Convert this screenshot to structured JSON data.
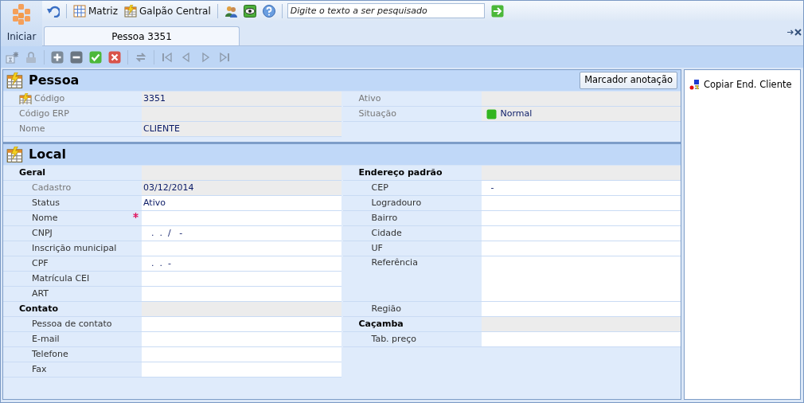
{
  "app_button": {
    "label": "Iniciar"
  },
  "top_toolbar": {
    "items": [
      {
        "kind": "undo"
      },
      {
        "kind": "grid",
        "label": "Matriz"
      },
      {
        "kind": "table",
        "label": "Galpão Central"
      },
      {
        "kind": "users"
      },
      {
        "kind": "eye"
      },
      {
        "kind": "help"
      }
    ],
    "search": {
      "placeholder": "Digite o texto a ser pesquisado"
    }
  },
  "tabs": [
    {
      "label": "Pessoa 3351",
      "selected": true
    }
  ],
  "record_toolbar": [
    {
      "kind": "new",
      "disabled": true
    },
    {
      "kind": "lock",
      "disabled": true
    },
    {
      "kind": "add",
      "disabled": false
    },
    {
      "kind": "remove",
      "disabled": false
    },
    {
      "kind": "save",
      "disabled": false
    },
    {
      "kind": "cancel",
      "disabled": false
    },
    {
      "kind": "refresh",
      "disabled": true
    },
    {
      "kind": "first",
      "disabled": true
    },
    {
      "kind": "prev",
      "disabled": true
    },
    {
      "kind": "next",
      "disabled": true
    },
    {
      "kind": "last",
      "disabled": true
    }
  ],
  "pessoa": {
    "title": "Pessoa",
    "button": "Marcador anotação",
    "left": [
      {
        "kind": "key_field",
        "label": "Código",
        "value": "3351",
        "readonly": true
      },
      {
        "kind": "field",
        "label": "Código ERP",
        "readonly": true
      },
      {
        "kind": "field",
        "label": "Nome",
        "value": "CLIENTE",
        "readonly": true
      }
    ],
    "right": [
      {
        "kind": "field",
        "label": "Ativo",
        "readonly": true
      },
      {
        "kind": "status",
        "label": "Situação",
        "value": "Normal",
        "readonly": true,
        "color": "#33b51e"
      }
    ]
  },
  "local": {
    "title": "Local",
    "left": [
      {
        "kind": "group",
        "label": "Geral"
      },
      {
        "kind": "field",
        "label": "Cadastro",
        "value": "03/12/2014",
        "readonly": true,
        "required": false
      },
      {
        "kind": "field",
        "label": "Status",
        "value": "Ativo",
        "readonly": false,
        "required": false
      },
      {
        "kind": "field",
        "label": "Nome",
        "readonly": false,
        "required": true
      },
      {
        "kind": "field",
        "label": "CNPJ",
        "value": ".  .  /   -",
        "readonly": false,
        "required": false
      },
      {
        "kind": "field",
        "label": "Inscrição municipal",
        "readonly": false,
        "required": false
      },
      {
        "kind": "field",
        "label": "CPF",
        "value": ".  .  -",
        "readonly": false,
        "required": false
      },
      {
        "kind": "field",
        "label": "Matrícula CEI",
        "readonly": false,
        "required": false
      },
      {
        "kind": "field",
        "label": "ART",
        "readonly": false,
        "required": false
      },
      {
        "kind": "group",
        "label": "Contato"
      },
      {
        "kind": "field",
        "label": "Pessoa de contato",
        "readonly": false,
        "required": false
      },
      {
        "kind": "field",
        "label": "E-mail",
        "readonly": false,
        "required": false
      },
      {
        "kind": "field",
        "label": "Telefone",
        "readonly": false,
        "required": false
      },
      {
        "kind": "field",
        "label": "Fax",
        "readonly": false,
        "required": false
      }
    ],
    "right": [
      {
        "kind": "group",
        "label": "Endereço padrão"
      },
      {
        "kind": "field",
        "label": "CEP",
        "value": "-",
        "readonly": false,
        "required": false
      },
      {
        "kind": "field",
        "label": "Logradouro",
        "readonly": false,
        "required": false
      },
      {
        "kind": "field",
        "label": "Bairro",
        "readonly": false,
        "required": false
      },
      {
        "kind": "field",
        "label": "Cidade",
        "readonly": false,
        "required": false
      },
      {
        "kind": "field",
        "label": "UF",
        "readonly": false,
        "required": false
      },
      {
        "kind": "memo",
        "label": "Referência",
        "readonly": false,
        "required": false
      },
      {
        "kind": "field",
        "label": "Região",
        "readonly": false,
        "required": false
      },
      {
        "kind": "group",
        "label": "Caçamba"
      },
      {
        "kind": "field",
        "label": "Tab. preço",
        "readonly": false,
        "required": false
      }
    ]
  },
  "side_panel": {
    "actions": [
      {
        "label": "Copiar End. Cliente"
      }
    ]
  }
}
